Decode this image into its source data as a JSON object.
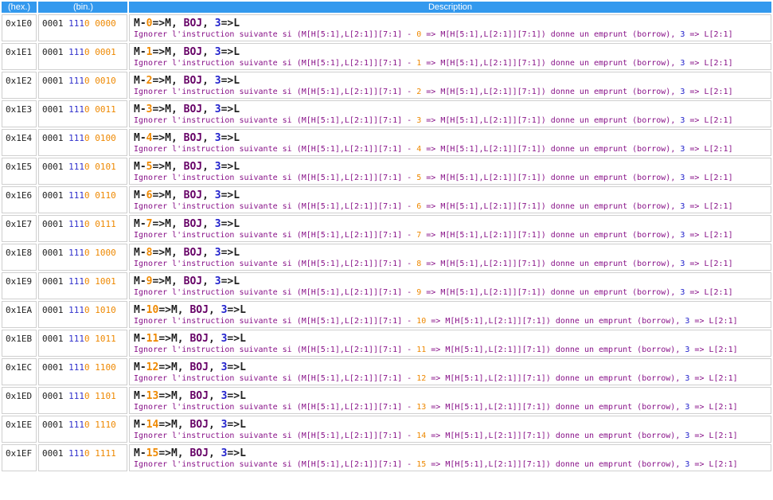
{
  "header": {
    "hex": "(hex.)",
    "bin": "(bin.)",
    "desc": "Description"
  },
  "rows": [
    {
      "hex": "0x1E0",
      "b1": "0001",
      "b2a": "111",
      "b2b": "0",
      "b3": "0000",
      "mn_pre": "M-",
      "num": "0",
      "mn_mid": "=>M, ",
      "boj": "BOJ",
      "sep": ", ",
      "three": "3",
      "mn_post": "=>L",
      "d_pre": "Ignorer l'instruction suivante si (M[H[5:1],L[2:1]][7:1] - ",
      "d_num": "0",
      "d_mid": " => M[H[5:1],L[2:1]][7:1]) donne un emprunt (borrow), ",
      "d_three": "3",
      "d_post": " => L[2:1]"
    },
    {
      "hex": "0x1E1",
      "b1": "0001",
      "b2a": "111",
      "b2b": "0",
      "b3": "0001",
      "mn_pre": "M-",
      "num": "1",
      "mn_mid": "=>M, ",
      "boj": "BOJ",
      "sep": ", ",
      "three": "3",
      "mn_post": "=>L",
      "d_pre": "Ignorer l'instruction suivante si (M[H[5:1],L[2:1]][7:1] - ",
      "d_num": "1",
      "d_mid": " => M[H[5:1],L[2:1]][7:1]) donne un emprunt (borrow), ",
      "d_three": "3",
      "d_post": " => L[2:1]"
    },
    {
      "hex": "0x1E2",
      "b1": "0001",
      "b2a": "111",
      "b2b": "0",
      "b3": "0010",
      "mn_pre": "M-",
      "num": "2",
      "mn_mid": "=>M, ",
      "boj": "BOJ",
      "sep": ", ",
      "three": "3",
      "mn_post": "=>L",
      "d_pre": "Ignorer l'instruction suivante si (M[H[5:1],L[2:1]][7:1] - ",
      "d_num": "2",
      "d_mid": " => M[H[5:1],L[2:1]][7:1]) donne un emprunt (borrow), ",
      "d_three": "3",
      "d_post": " => L[2:1]"
    },
    {
      "hex": "0x1E3",
      "b1": "0001",
      "b2a": "111",
      "b2b": "0",
      "b3": "0011",
      "mn_pre": "M-",
      "num": "3",
      "mn_mid": "=>M, ",
      "boj": "BOJ",
      "sep": ", ",
      "three": "3",
      "mn_post": "=>L",
      "d_pre": "Ignorer l'instruction suivante si (M[H[5:1],L[2:1]][7:1] - ",
      "d_num": "3",
      "d_mid": " => M[H[5:1],L[2:1]][7:1]) donne un emprunt (borrow), ",
      "d_three": "3",
      "d_post": " => L[2:1]"
    },
    {
      "hex": "0x1E4",
      "b1": "0001",
      "b2a": "111",
      "b2b": "0",
      "b3": "0100",
      "mn_pre": "M-",
      "num": "4",
      "mn_mid": "=>M, ",
      "boj": "BOJ",
      "sep": ", ",
      "three": "3",
      "mn_post": "=>L",
      "d_pre": "Ignorer l'instruction suivante si (M[H[5:1],L[2:1]][7:1] - ",
      "d_num": "4",
      "d_mid": " => M[H[5:1],L[2:1]][7:1]) donne un emprunt (borrow), ",
      "d_three": "3",
      "d_post": " => L[2:1]"
    },
    {
      "hex": "0x1E5",
      "b1": "0001",
      "b2a": "111",
      "b2b": "0",
      "b3": "0101",
      "mn_pre": "M-",
      "num": "5",
      "mn_mid": "=>M, ",
      "boj": "BOJ",
      "sep": ", ",
      "three": "3",
      "mn_post": "=>L",
      "d_pre": "Ignorer l'instruction suivante si (M[H[5:1],L[2:1]][7:1] - ",
      "d_num": "5",
      "d_mid": " => M[H[5:1],L[2:1]][7:1]) donne un emprunt (borrow), ",
      "d_three": "3",
      "d_post": " => L[2:1]"
    },
    {
      "hex": "0x1E6",
      "b1": "0001",
      "b2a": "111",
      "b2b": "0",
      "b3": "0110",
      "mn_pre": "M-",
      "num": "6",
      "mn_mid": "=>M, ",
      "boj": "BOJ",
      "sep": ", ",
      "three": "3",
      "mn_post": "=>L",
      "d_pre": "Ignorer l'instruction suivante si (M[H[5:1],L[2:1]][7:1] - ",
      "d_num": "6",
      "d_mid": " => M[H[5:1],L[2:1]][7:1]) donne un emprunt (borrow), ",
      "d_three": "3",
      "d_post": " => L[2:1]"
    },
    {
      "hex": "0x1E7",
      "b1": "0001",
      "b2a": "111",
      "b2b": "0",
      "b3": "0111",
      "mn_pre": "M-",
      "num": "7",
      "mn_mid": "=>M, ",
      "boj": "BOJ",
      "sep": ", ",
      "three": "3",
      "mn_post": "=>L",
      "d_pre": "Ignorer l'instruction suivante si (M[H[5:1],L[2:1]][7:1] - ",
      "d_num": "7",
      "d_mid": " => M[H[5:1],L[2:1]][7:1]) donne un emprunt (borrow), ",
      "d_three": "3",
      "d_post": " => L[2:1]"
    },
    {
      "hex": "0x1E8",
      "b1": "0001",
      "b2a": "111",
      "b2b": "0",
      "b3": "1000",
      "mn_pre": "M-",
      "num": "8",
      "mn_mid": "=>M, ",
      "boj": "BOJ",
      "sep": ", ",
      "three": "3",
      "mn_post": "=>L",
      "d_pre": "Ignorer l'instruction suivante si (M[H[5:1],L[2:1]][7:1] - ",
      "d_num": "8",
      "d_mid": " => M[H[5:1],L[2:1]][7:1]) donne un emprunt (borrow), ",
      "d_three": "3",
      "d_post": " => L[2:1]"
    },
    {
      "hex": "0x1E9",
      "b1": "0001",
      "b2a": "111",
      "b2b": "0",
      "b3": "1001",
      "mn_pre": "M-",
      "num": "9",
      "mn_mid": "=>M, ",
      "boj": "BOJ",
      "sep": ", ",
      "three": "3",
      "mn_post": "=>L",
      "d_pre": "Ignorer l'instruction suivante si (M[H[5:1],L[2:1]][7:1] - ",
      "d_num": "9",
      "d_mid": " => M[H[5:1],L[2:1]][7:1]) donne un emprunt (borrow), ",
      "d_three": "3",
      "d_post": " => L[2:1]"
    },
    {
      "hex": "0x1EA",
      "b1": "0001",
      "b2a": "111",
      "b2b": "0",
      "b3": "1010",
      "mn_pre": "M-",
      "num": "10",
      "mn_mid": "=>M, ",
      "boj": "BOJ",
      "sep": ", ",
      "three": "3",
      "mn_post": "=>L",
      "d_pre": "Ignorer l'instruction suivante si (M[H[5:1],L[2:1]][7:1] - ",
      "d_num": "10",
      "d_mid": " => M[H[5:1],L[2:1]][7:1]) donne un emprunt (borrow), ",
      "d_three": "3",
      "d_post": " => L[2:1]"
    },
    {
      "hex": "0x1EB",
      "b1": "0001",
      "b2a": "111",
      "b2b": "0",
      "b3": "1011",
      "mn_pre": "M-",
      "num": "11",
      "mn_mid": "=>M, ",
      "boj": "BOJ",
      "sep": ", ",
      "three": "3",
      "mn_post": "=>L",
      "d_pre": "Ignorer l'instruction suivante si (M[H[5:1],L[2:1]][7:1] - ",
      "d_num": "11",
      "d_mid": " => M[H[5:1],L[2:1]][7:1]) donne un emprunt (borrow), ",
      "d_three": "3",
      "d_post": " => L[2:1]"
    },
    {
      "hex": "0x1EC",
      "b1": "0001",
      "b2a": "111",
      "b2b": "0",
      "b3": "1100",
      "mn_pre": "M-",
      "num": "12",
      "mn_mid": "=>M, ",
      "boj": "BOJ",
      "sep": ", ",
      "three": "3",
      "mn_post": "=>L",
      "d_pre": "Ignorer l'instruction suivante si (M[H[5:1],L[2:1]][7:1] - ",
      "d_num": "12",
      "d_mid": " => M[H[5:1],L[2:1]][7:1]) donne un emprunt (borrow), ",
      "d_three": "3",
      "d_post": " => L[2:1]"
    },
    {
      "hex": "0x1ED",
      "b1": "0001",
      "b2a": "111",
      "b2b": "0",
      "b3": "1101",
      "mn_pre": "M-",
      "num": "13",
      "mn_mid": "=>M, ",
      "boj": "BOJ",
      "sep": ", ",
      "three": "3",
      "mn_post": "=>L",
      "d_pre": "Ignorer l'instruction suivante si (M[H[5:1],L[2:1]][7:1] - ",
      "d_num": "13",
      "d_mid": " => M[H[5:1],L[2:1]][7:1]) donne un emprunt (borrow), ",
      "d_three": "3",
      "d_post": " => L[2:1]"
    },
    {
      "hex": "0x1EE",
      "b1": "0001",
      "b2a": "111",
      "b2b": "0",
      "b3": "1110",
      "mn_pre": "M-",
      "num": "14",
      "mn_mid": "=>M, ",
      "boj": "BOJ",
      "sep": ", ",
      "three": "3",
      "mn_post": "=>L",
      "d_pre": "Ignorer l'instruction suivante si (M[H[5:1],L[2:1]][7:1] - ",
      "d_num": "14",
      "d_mid": " => M[H[5:1],L[2:1]][7:1]) donne un emprunt (borrow), ",
      "d_three": "3",
      "d_post": " => L[2:1]"
    },
    {
      "hex": "0x1EF",
      "b1": "0001",
      "b2a": "111",
      "b2b": "0",
      "b3": "1111",
      "mn_pre": "M-",
      "num": "15",
      "mn_mid": "=>M, ",
      "boj": "BOJ",
      "sep": ", ",
      "three": "3",
      "mn_post": "=>L",
      "d_pre": "Ignorer l'instruction suivante si (M[H[5:1],L[2:1]][7:1] - ",
      "d_num": "15",
      "d_mid": " => M[H[5:1],L[2:1]][7:1]) donne un emprunt (borrow), ",
      "d_three": "3",
      "d_post": " => L[2:1]"
    }
  ]
}
